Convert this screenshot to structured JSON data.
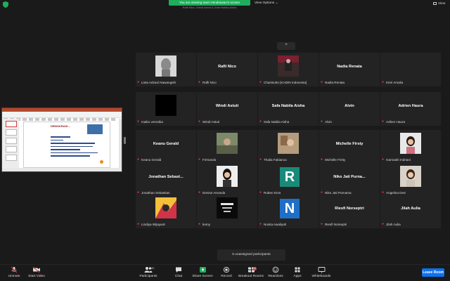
{
  "share_banner": {
    "text": "You are viewing Iwan Hendrawan's screen",
    "subtitle": "Rafli Nico, Windi Astuti & Safa Nabila Aisha"
  },
  "view_options": "View Options ⌄",
  "view_button": "View",
  "gallery": {
    "tiles": [
      {
        "label": "Lieta Adzani Nawangsih",
        "name": "",
        "kind": "photo",
        "photo": "statue"
      },
      {
        "label": "Rafli Nico",
        "name": "Rafli Nico",
        "kind": "name"
      },
      {
        "label": "Charisiotto [KADIN Indonesia]",
        "name": "",
        "kind": "photo",
        "photo": "office"
      },
      {
        "label": "Nadia Renata",
        "name": "Nadia Renata",
        "kind": "name"
      },
      {
        "label": "Kirei Amalia",
        "name": "",
        "kind": "blank"
      },
      {
        "label": "maiko veronika",
        "name": "",
        "kind": "photo",
        "photo": "black"
      },
      {
        "label": "Windi Astuti",
        "name": "Windi Astuti",
        "kind": "name"
      },
      {
        "label": "Safa Nabila Aisha",
        "name": "Safa Nabila Aisha",
        "kind": "name"
      },
      {
        "label": "Alvin",
        "name": "Alvin",
        "kind": "name"
      },
      {
        "label": "Adrien Haura",
        "name": "Adrien Haura",
        "kind": "name"
      },
      {
        "label": "Keanu Gerald",
        "name": "Keanu Gerald",
        "kind": "name"
      },
      {
        "label": "Firmanda",
        "name": "",
        "kind": "photo",
        "photo": "outdoor"
      },
      {
        "label": "Thalia Fabianca",
        "name": "",
        "kind": "photo",
        "photo": "room"
      },
      {
        "label": "Michelle Firsty",
        "name": "Michelle Firsty",
        "kind": "name"
      },
      {
        "label": "Garnaish Indriani",
        "name": "",
        "kind": "photo",
        "photo": "woman"
      },
      {
        "label": "Jonathan Sebastian",
        "name": "Jonathan  Sebast...",
        "kind": "name"
      },
      {
        "label": "Denise Amanda",
        "name": "",
        "kind": "photo",
        "photo": "woman2"
      },
      {
        "label": "Ruben Eros",
        "name": "",
        "kind": "letter",
        "letter": "R",
        "color": "#1a8a7a"
      },
      {
        "label": "Niko Jati Purnama",
        "name": "Niko Jati  Purna...",
        "kind": "name"
      },
      {
        "label": "Angelina Devi",
        "name": "",
        "kind": "photo",
        "photo": "woman3"
      },
      {
        "label": "Lindiya Wijayanti",
        "name": "",
        "kind": "photo",
        "photo": "art"
      },
      {
        "label": "leony",
        "name": "",
        "kind": "photo",
        "photo": "chart"
      },
      {
        "label": "Novita Awaliyah",
        "name": "",
        "kind": "letter",
        "letter": "N",
        "color": "#1f6fc7"
      },
      {
        "label": "Riesfi Norseptri",
        "name": "Riesfi Norseptri",
        "kind": "name"
      },
      {
        "label": "Jilah Aulia",
        "name": "Jilah Aulia",
        "kind": "name"
      }
    ]
  },
  "unassigned": "5 unassigned participants",
  "shared_slide": {
    "title": "DEMOKRASI..."
  },
  "toolbar": {
    "unmute": "Unmute",
    "start_video": "Start Video",
    "participants": "Participants",
    "participants_count": "42",
    "chat": "Chat",
    "share_screen": "Share Screen",
    "record": "Record",
    "breakout_rooms": "Breakout Rooms",
    "reactions": "Reactions",
    "apps": "Apps",
    "whiteboards": "Whiteboards",
    "leave_room": "Leave Room"
  },
  "colors": {
    "share_green": "#1fae5b",
    "leave_blue": "#0e72ed",
    "mic_red": "#e0393e"
  },
  "icons": {
    "unmute": "muted-mic-icon",
    "start_video": "video-off-icon",
    "participants": "participants-icon",
    "chat": "chat-icon",
    "share_screen": "share-screen-icon",
    "record": "record-icon",
    "breakout_rooms": "breakout-rooms-icon",
    "reactions": "reactions-icon",
    "apps": "apps-icon",
    "whiteboards": "whiteboard-icon"
  }
}
